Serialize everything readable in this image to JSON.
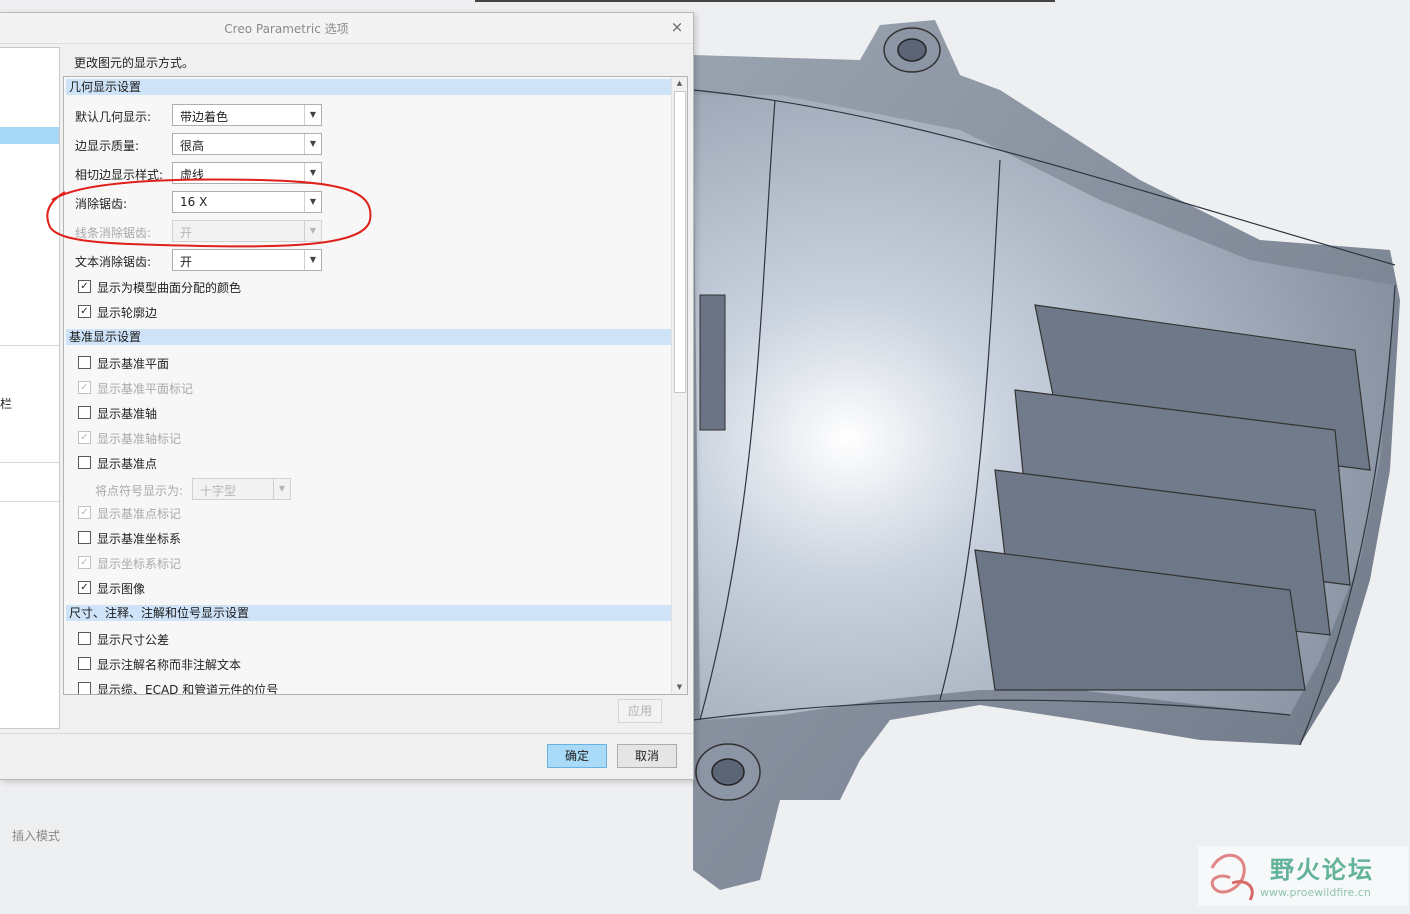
{
  "dialog": {
    "title": "Creo Parametric 选项",
    "close_glyph": "×",
    "description": "更改图元的显示方式。",
    "left_panel_fragment": "栏"
  },
  "geometry_section": {
    "header": "几何显示设置",
    "rows": [
      {
        "label": "默认几何显示:",
        "value": "带边着色",
        "disabled": false
      },
      {
        "label": "边显示质量:",
        "value": "很高",
        "disabled": false
      },
      {
        "label": "相切边显示样式:",
        "value": "虚线",
        "disabled": false
      },
      {
        "label": "消除锯齿:",
        "value": "16 X",
        "disabled": false
      },
      {
        "label": "线条消除锯齿:",
        "value": "开",
        "disabled": true
      },
      {
        "label": "文本消除锯齿:",
        "value": "开",
        "disabled": false
      }
    ],
    "checks": [
      {
        "label": "显示为模型曲面分配的颜色",
        "checked": true,
        "disabled": false
      },
      {
        "label": "显示轮廓边",
        "checked": true,
        "disabled": false
      }
    ]
  },
  "datum_section": {
    "header": "基准显示设置",
    "checks": [
      {
        "label": "显示基准平面",
        "checked": false,
        "disabled": false
      },
      {
        "label": "显示基准平面标记",
        "checked": true,
        "disabled": true
      },
      {
        "label": "显示基准轴",
        "checked": false,
        "disabled": false
      },
      {
        "label": "显示基准轴标记",
        "checked": true,
        "disabled": true
      },
      {
        "label": "显示基准点",
        "checked": false,
        "disabled": false
      }
    ],
    "point_symbol": {
      "label": "将点符号显示为:",
      "value": "十字型",
      "disabled": true
    },
    "checks2": [
      {
        "label": "显示基准点标记",
        "checked": true,
        "disabled": true
      },
      {
        "label": "显示基准坐标系",
        "checked": false,
        "disabled": false
      },
      {
        "label": "显示坐标系标记",
        "checked": true,
        "disabled": true
      },
      {
        "label": "显示图像",
        "checked": true,
        "disabled": false
      }
    ]
  },
  "annotation_section": {
    "header": "尺寸、注释、注解和位号显示设置",
    "checks": [
      {
        "label": "显示尺寸公差",
        "checked": false,
        "disabled": false
      },
      {
        "label": "显示注解名称而非注解文本",
        "checked": false,
        "disabled": false
      },
      {
        "label": "显示缆、ECAD 和管道元件的位号",
        "checked": false,
        "disabled": false
      }
    ]
  },
  "buttons": {
    "apply": "应用",
    "ok": "确定",
    "cancel": "取消"
  },
  "check_glyph": "✓",
  "dropdown_glyph": "▼",
  "scroll_up_glyph": "▲",
  "scroll_down_glyph": "▼",
  "status_bar": {
    "mode": "插入模式"
  },
  "watermark": {
    "title": "野火论坛",
    "url": "www.proewildfire.cn"
  },
  "colors": {
    "section_header": "#cfe3f8",
    "primary_button": "#a9daf8",
    "annotation_circle": "#e0201a",
    "model_surface": "#b9c2cf"
  }
}
